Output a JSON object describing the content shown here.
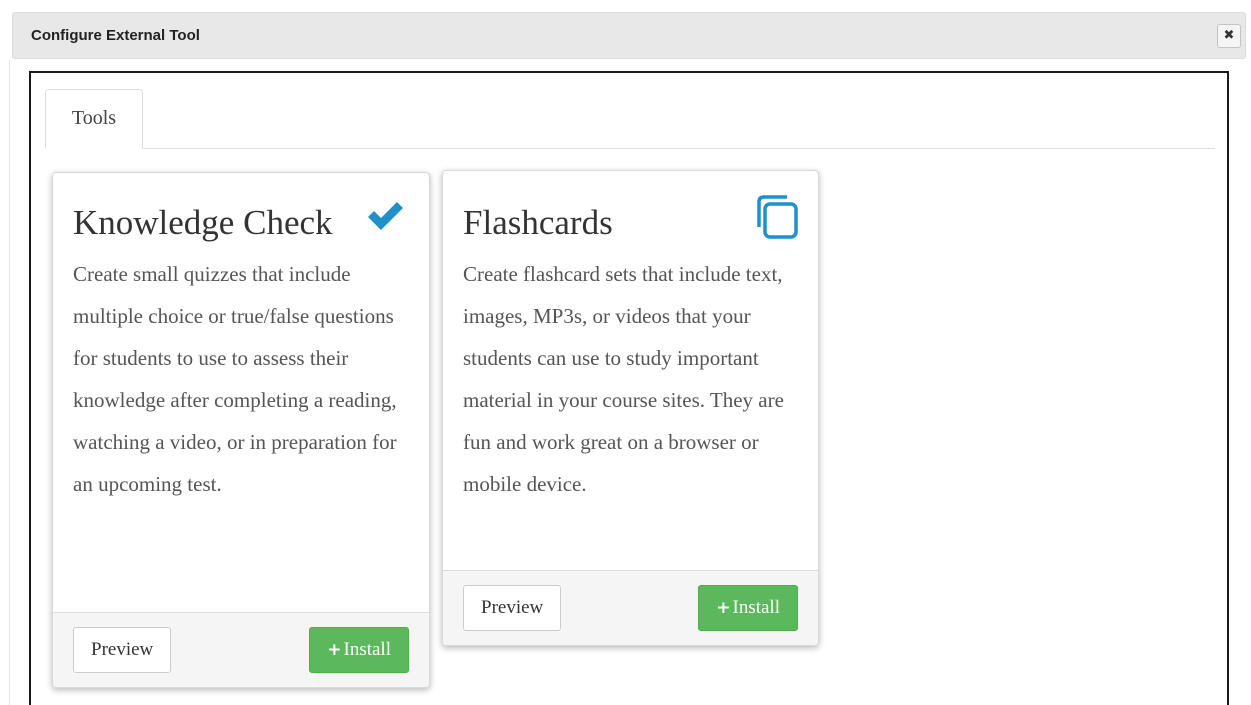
{
  "dialog": {
    "title": "Configure External Tool",
    "close_glyph": "✖"
  },
  "tabs": [
    {
      "label": "Tools",
      "active": true
    }
  ],
  "colors": {
    "accent_blue": "#1f90c9",
    "install_green": "#5cb85c"
  },
  "tools": [
    {
      "title": "Knowledge Check",
      "status_icon": "checkmark-icon",
      "description": "Create small quizzes that include multiple choice or true/false questions for students to use to assess their knowledge after completing a reading, watching a video, or in preparation for an upcoming test.",
      "preview_label": "Preview",
      "install_icon": "+",
      "install_label": "Install"
    },
    {
      "title": "Flashcards",
      "status_icon": "copy-icon",
      "description": "Create flashcard sets that include text, images, MP3s, or videos that your students can use to study important material in your course sites. They are fun and work great on a browser or mobile device.",
      "preview_label": "Preview",
      "install_icon": "+",
      "install_label": "Install"
    }
  ]
}
